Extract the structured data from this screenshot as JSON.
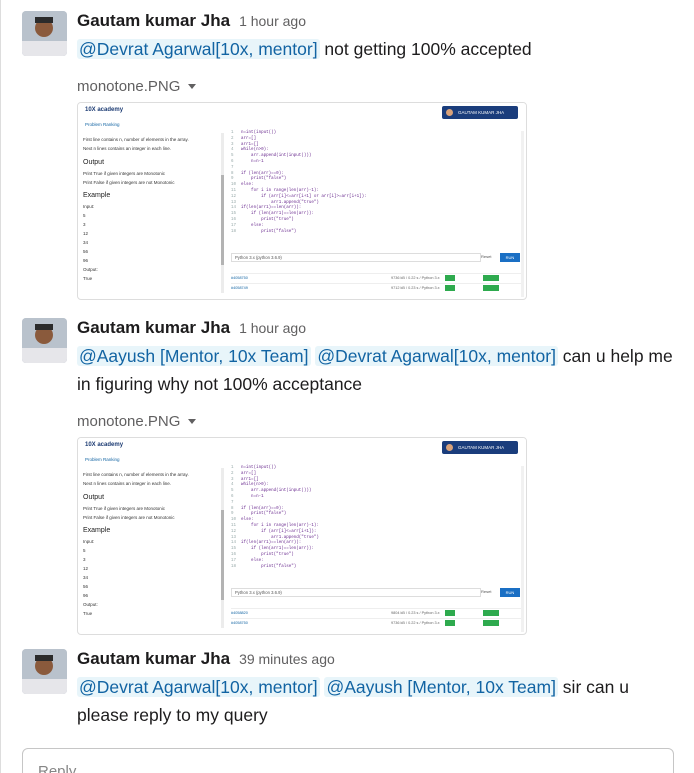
{
  "messages": [
    {
      "author": "Gautam kumar Jha",
      "time": "1 hour ago",
      "parts": [
        {
          "type": "mention",
          "text": "@Devrat Agarwal[10x, mentor]"
        },
        {
          "type": "text",
          "text": " not getting 100% accepted"
        }
      ],
      "file": {
        "name": "monotone.PNG",
        "shot": {
          "logo": "10X academy",
          "user": "GAUTAM KUMAR JHA",
          "tabs": "Problem    Ranking",
          "lines": [
            "First line contains n, number of elements in the array.",
            "Next n lines contains an integer in each line."
          ],
          "output_heading": "Output",
          "output_lines": [
            "Print True if given integers are Monotonic",
            "Print False if given integers are not Monotonic"
          ],
          "example_heading": "Example",
          "example_vals": [
            "Input:",
            "5",
            "3",
            "12",
            "34",
            "56",
            "96",
            "Output:",
            "True"
          ],
          "code": [
            "n=int(input())",
            "arr=[]",
            "arr1=[]",
            "while(n>0):",
            "    arr.append(int(input()))",
            "    n=n-1",
            "",
            "if (len(arr)==0):",
            "    print(\"false\")",
            "else:",
            "    for i in range(len(arr)-1):",
            "        if (arr[i]<=arr[i+1] or arr[i]>=arr[i+1]):",
            "            arr1.append(\"true\")",
            "if(len(arr1)==len(arr)):",
            "    if (len(arr1)==len(arr)):",
            "        print(\"true\")",
            "    else:",
            "        print(\"false\")"
          ],
          "language": "Python 3.x (python 3.6.9)",
          "reset": "Reset",
          "run": "RUN",
          "submissions": [
            {
              "id": "#4058750",
              "mem": "9736 kB / 0.22 s / Python 3.x"
            },
            {
              "id": "#4058749",
              "mem": "9712 kB / 0.23 s / Python 3.x"
            }
          ]
        }
      }
    },
    {
      "author": "Gautam kumar Jha",
      "time": "1 hour ago",
      "parts": [
        {
          "type": "mention",
          "text": "@Aayush [Mentor, 10x Team]"
        },
        {
          "type": "text",
          "text": " "
        },
        {
          "type": "mention",
          "text": "@Devrat Agarwal[10x, mentor]"
        },
        {
          "type": "text",
          "text": " can u help me in figuring why not 100% acceptance"
        }
      ],
      "file": {
        "name": "monotone.PNG",
        "shot": {
          "logo": "10X academy",
          "user": "GAUTAM KUMAR JHA",
          "tabs": "Problem    Ranking",
          "lines": [
            "First line contains n, number of elements in the array.",
            "Next n lines contains an integer in each line."
          ],
          "output_heading": "Output",
          "output_lines": [
            "Print True if given integers are Monotonic",
            "Print False if given integers are not Monotonic"
          ],
          "example_heading": "Example",
          "example_vals": [
            "Input:",
            "5",
            "3",
            "12",
            "34",
            "56",
            "96",
            "Output:",
            "True"
          ],
          "code": [
            "n=int(input())",
            "arr=[]",
            "arr1=[]",
            "while(n>0):",
            "    arr.append(int(input()))",
            "    n=n-1",
            "",
            "if (len(arr)==0):",
            "    print(\"false\")",
            "else:",
            "    for i in range(len(arr)-1):",
            "        if (arr[i]<=arr[i+1]):",
            "            arr1.append(\"true\")",
            "if(len(arr1)==len(arr)):",
            "    if (len(arr1)==len(arr)):",
            "        print(\"true\")",
            "    else:",
            "        print(\"false\")"
          ],
          "language": "Python 3.x (python 3.6.9)",
          "reset": "Reset",
          "run": "RUN",
          "submissions": [
            {
              "id": "#4058820",
              "mem": "9804 kB / 0.23 s / Python 3.x"
            },
            {
              "id": "#4058750",
              "mem": "9736 kB / 0.22 s / Python 3.x"
            }
          ]
        }
      }
    },
    {
      "author": "Gautam kumar Jha",
      "time": "39 minutes ago",
      "parts": [
        {
          "type": "mention",
          "text": "@Devrat Agarwal[10x, mentor]"
        },
        {
          "type": "text",
          "text": " "
        },
        {
          "type": "mention",
          "text": "@Aayush [Mentor, 10x Team]"
        },
        {
          "type": "text",
          "text": " sir can u please reply to my query"
        }
      ]
    }
  ],
  "composer": {
    "placeholder": "Reply..."
  },
  "colors": {
    "mention_bg": "#e8f5fa",
    "mention_text": "#1264a3",
    "accepted": "#2eaa4e",
    "brand": "#1a3d7c"
  }
}
